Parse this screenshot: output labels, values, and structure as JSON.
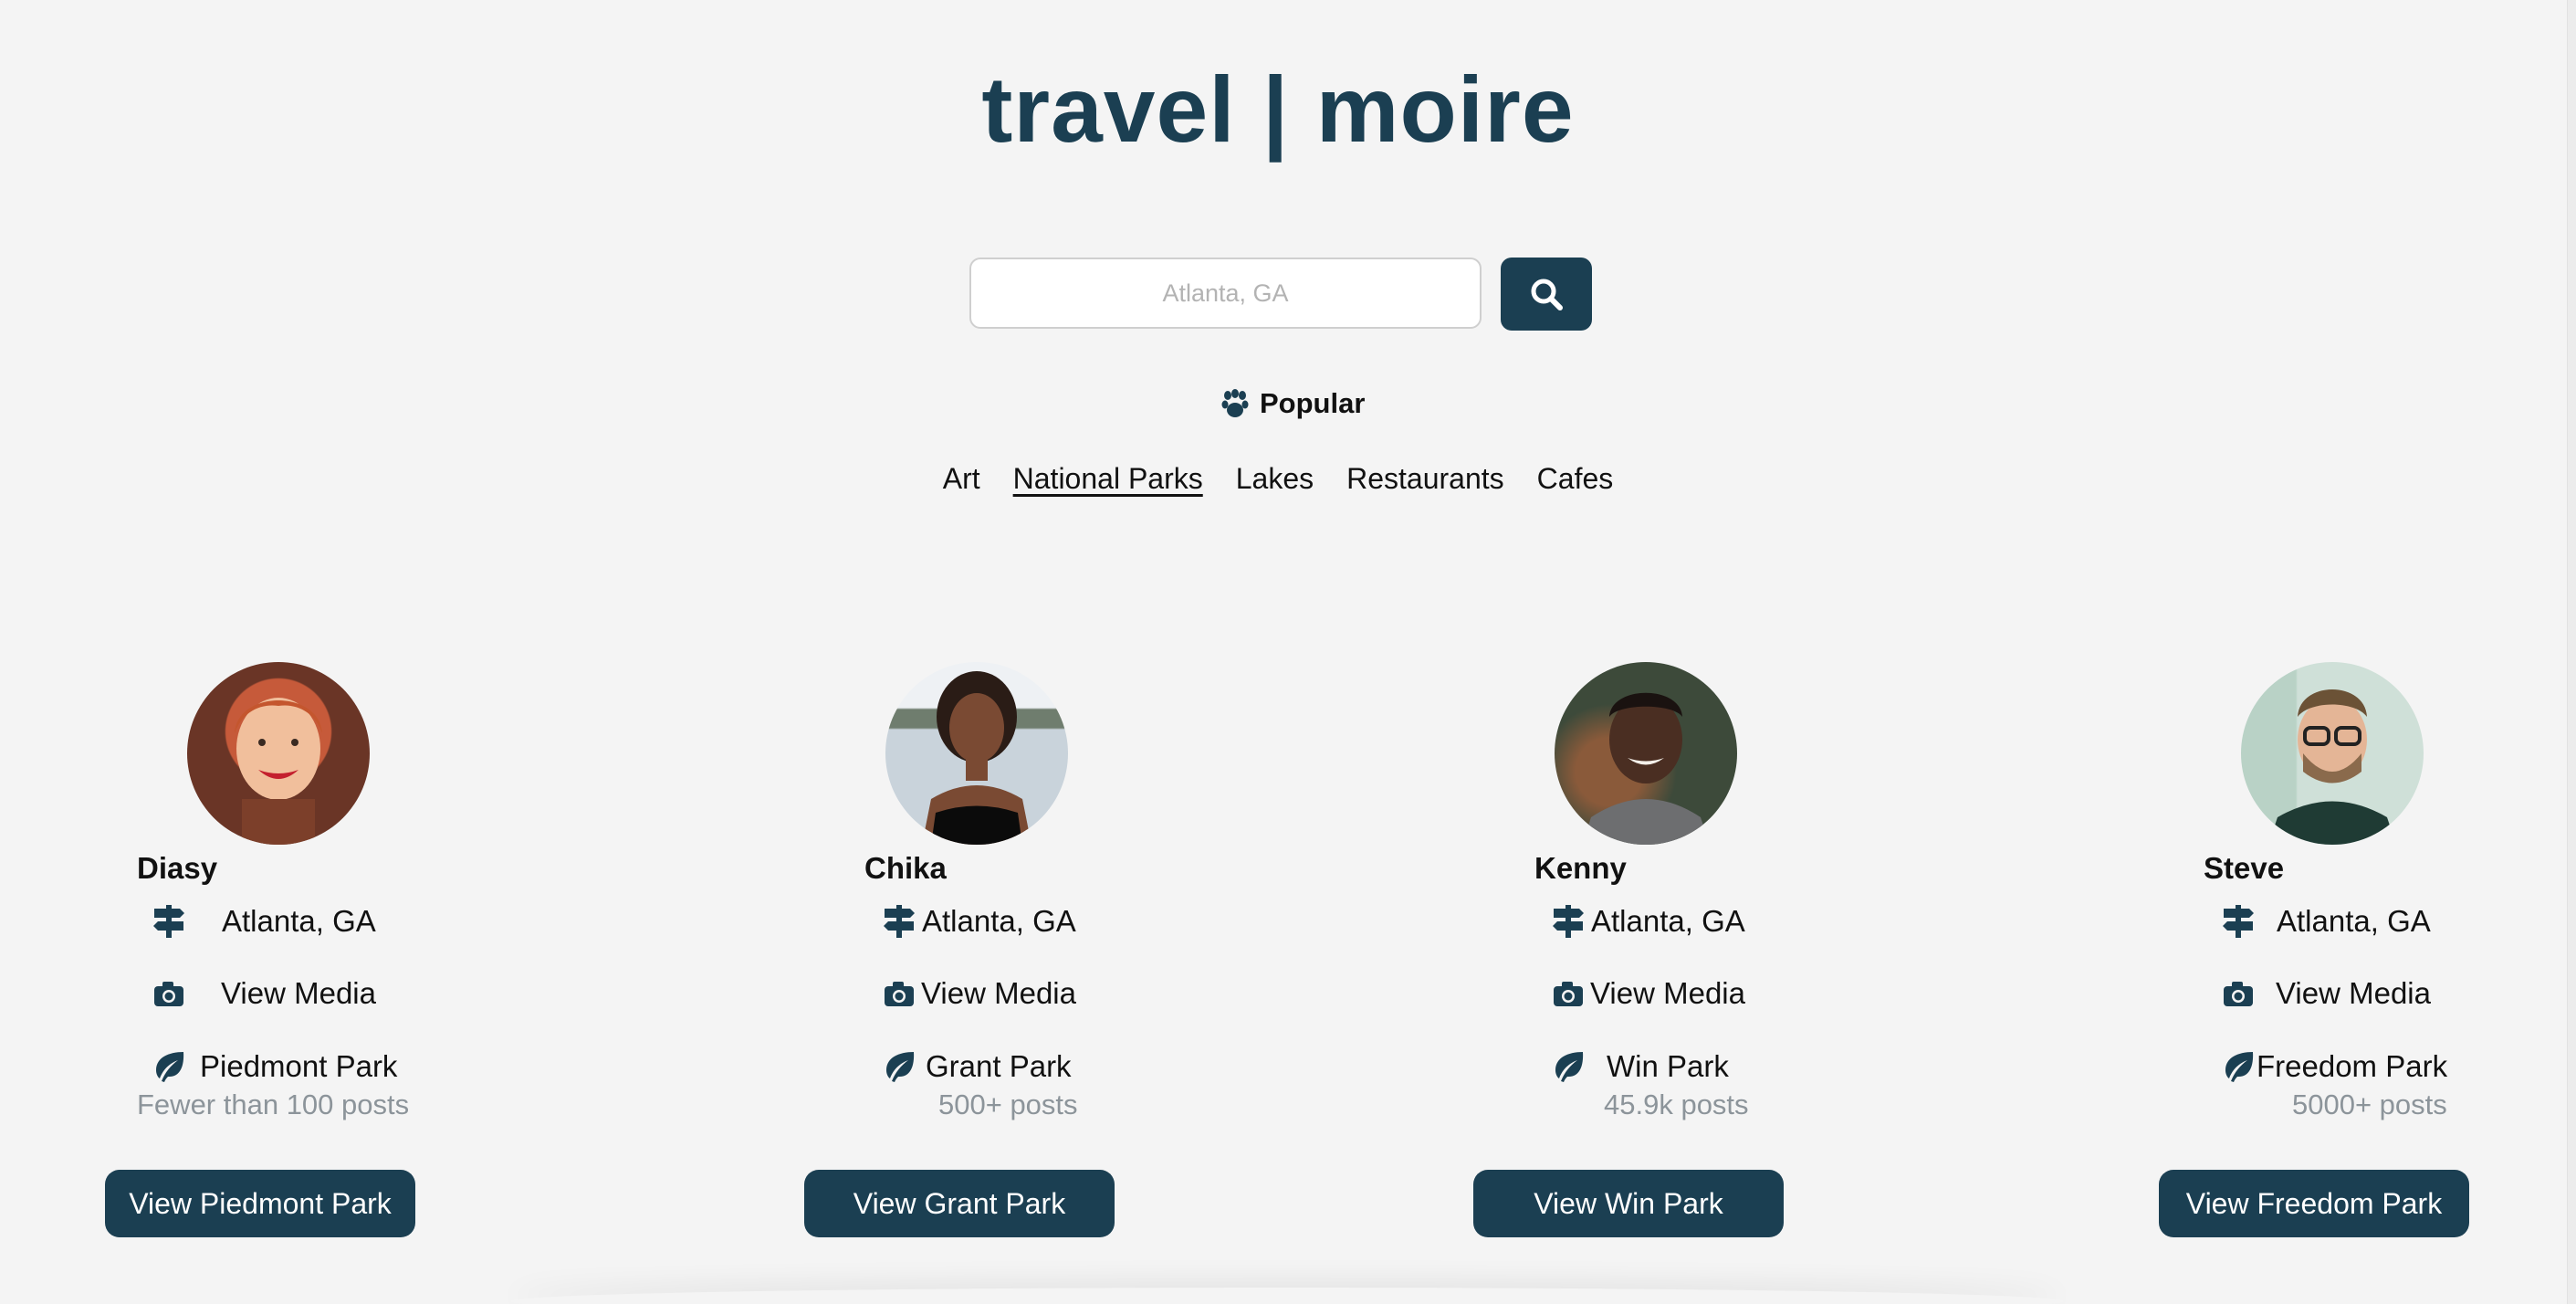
{
  "header": {
    "title": "travel | moire"
  },
  "search": {
    "placeholder": "Atlanta, GA",
    "icon": "search-icon"
  },
  "popular": {
    "label": "Popular",
    "icon": "paw-icon"
  },
  "categories": [
    {
      "label": "Art",
      "active": false
    },
    {
      "label": "National Parks",
      "active": true
    },
    {
      "label": "Lakes",
      "active": false
    },
    {
      "label": "Restaurants",
      "active": false
    },
    {
      "label": "Cafes",
      "active": false
    }
  ],
  "colors": {
    "brand": "#1b3f52",
    "background": "#f4f4f4",
    "muted": "#8c949a"
  },
  "cards": [
    {
      "name": "Diasy",
      "location": "Atlanta, GA",
      "media": "View Media",
      "park": "Piedmont Park",
      "posts": "Fewer than 100 posts",
      "button": "View Piedmont Park"
    },
    {
      "name": "Chika",
      "location": "Atlanta, GA",
      "media": "View Media",
      "park": "Grant Park",
      "posts": "500+ posts",
      "button": "View Grant Park"
    },
    {
      "name": "Kenny",
      "location": "Atlanta, GA",
      "media": "View Media",
      "park": "Win Park",
      "posts": "45.9k posts",
      "button": "View Win Park"
    },
    {
      "name": "Steve",
      "location": "Atlanta, GA",
      "media": "View Media",
      "park": "Freedom Park",
      "posts": "5000+ posts",
      "button": "View Freedom Park"
    }
  ]
}
